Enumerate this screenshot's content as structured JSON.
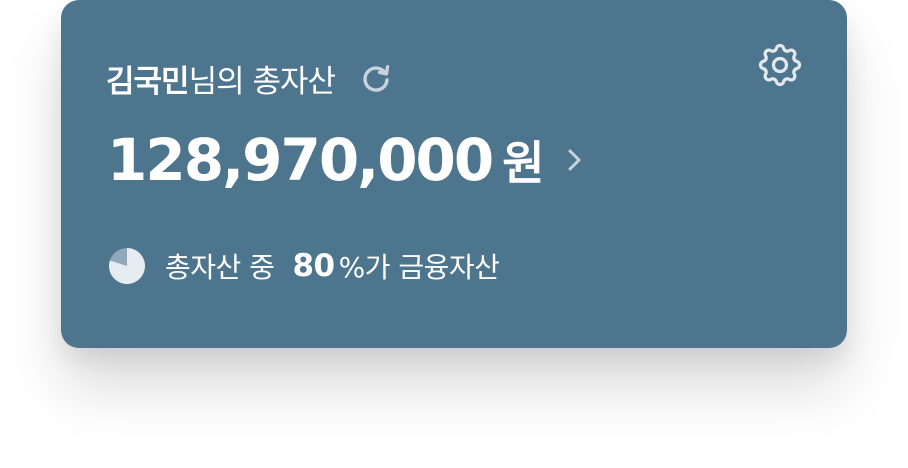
{
  "asset_card": {
    "user_name": "김국민",
    "title_suffix": "님의 총자산",
    "total_amount": "128,970,000",
    "currency_unit": "원",
    "summary_prefix": "총자산 중",
    "financial_percent": "80",
    "summary_suffix": "%가 금융자산",
    "financial_ratio": 0.8,
    "icons": {
      "refresh": "refresh-icon",
      "settings": "gear-icon",
      "chevron": "chevron-right-icon",
      "pie": "pie-chart-icon"
    },
    "colors": {
      "card_background": "#4e758e",
      "text": "#ffffff",
      "muted_icon": "#c7d4dd"
    }
  }
}
